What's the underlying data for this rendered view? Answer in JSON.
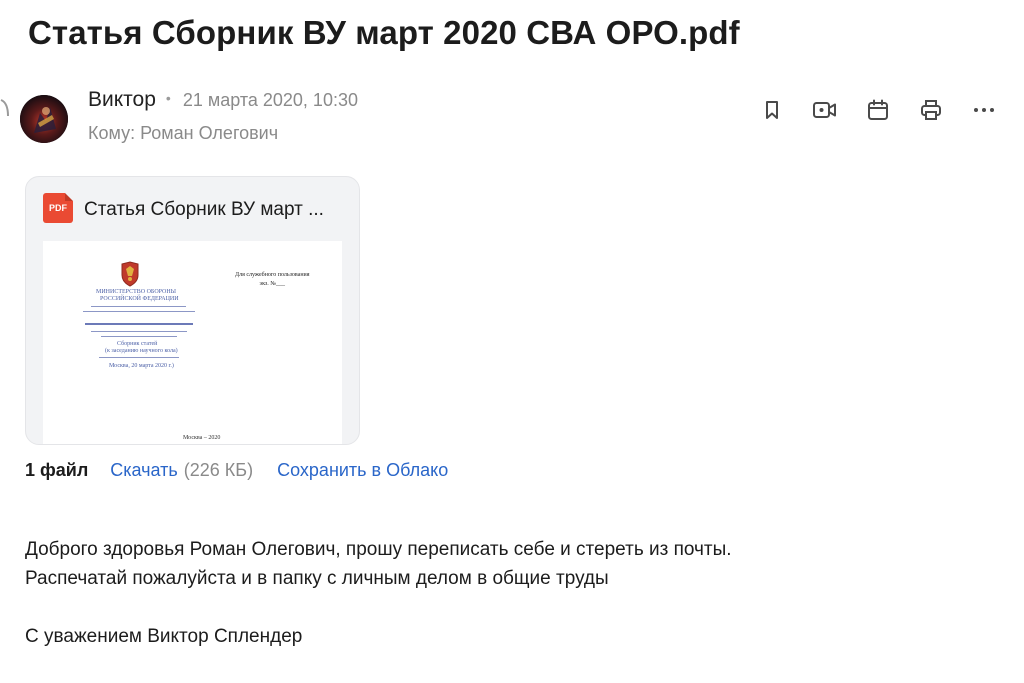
{
  "message": {
    "subject": "Статья Сборник ВУ март 2020 СВА ОРО.pdf",
    "sender_name": "Виктор",
    "separator": "•",
    "date": "21 марта 2020, 10:30",
    "recipient_line": "Кому: Роман Олегович"
  },
  "toolbar": {
    "icons": [
      "bookmark-icon",
      "video-call-icon",
      "calendar-icon",
      "print-icon",
      "more-icon"
    ]
  },
  "attachment": {
    "badge": "PDF",
    "name": "Статья Сборник ВУ март ...",
    "preview": {
      "top_right_line1": "Для служебного пользования",
      "top_right_line2": "экз. №___",
      "ministry_line1": "МИНИСТЕРСТВО ОБОРОНЫ",
      "ministry_line2": "РОССИЙСКОЙ ФЕДЕРАЦИИ",
      "collection_line1": "Сборник статей",
      "collection_line2": "(к заседанию научного кола)",
      "city_date": "Москва, 20 марта 2020 г.)",
      "footer": "Москва – 2020"
    }
  },
  "files": {
    "count_label": "1 файл",
    "download_label": "Скачать",
    "size": "(226 КБ)",
    "save_label": "Сохранить в Облако"
  },
  "body": {
    "line1": "Доброго здоровья Роман Олегович, прошу переписать себе и стереть из почты.",
    "line2": "Распечатай пожалуйста и в папку с личным делом в общие труды",
    "signature": "С уважением Виктор Сплендер"
  },
  "colors": {
    "link": "#2a66c9",
    "muted": "#8a8a8a",
    "pdf_badge": "#ea4a33",
    "card_bg": "#f2f3f5"
  }
}
